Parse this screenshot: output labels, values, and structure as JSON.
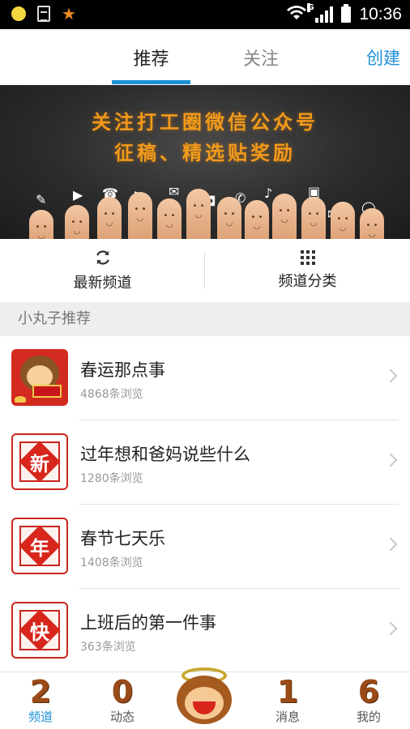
{
  "status_bar": {
    "time": "10:36",
    "network": "G"
  },
  "header": {
    "tabs": [
      {
        "label": "推荐",
        "active": true
      },
      {
        "label": "关注",
        "active": false
      }
    ],
    "create_label": "创建",
    "accent": "#1e90d6"
  },
  "banner": {
    "line1": "关注打工圈微信公众号",
    "line2": "征稿、精选贴奖励"
  },
  "quick_actions": [
    {
      "label": "最新频道",
      "icon": "refresh-icon"
    },
    {
      "label": "频道分类",
      "icon": "grid-icon"
    }
  ],
  "section": {
    "title": "小丸子推荐"
  },
  "channels": [
    {
      "title": "春运那点事",
      "views": "4868条浏览",
      "thumb": "monkey"
    },
    {
      "title": "过年想和爸妈说些什么",
      "views": "1280条浏览",
      "thumb": "char",
      "char": "新"
    },
    {
      "title": "春节七天乐",
      "views": "1408条浏览",
      "thumb": "char",
      "char": "年"
    },
    {
      "title": "上班后的第一件事",
      "views": "363条浏览",
      "thumb": "char",
      "char": "快"
    }
  ],
  "bottom_nav": [
    {
      "num": "2",
      "label": "频道",
      "active": true
    },
    {
      "num": "0",
      "label": "动态",
      "active": false
    },
    {
      "num": "1",
      "label": "消息",
      "active": false
    },
    {
      "num": "6",
      "label": "我的",
      "active": false
    }
  ]
}
